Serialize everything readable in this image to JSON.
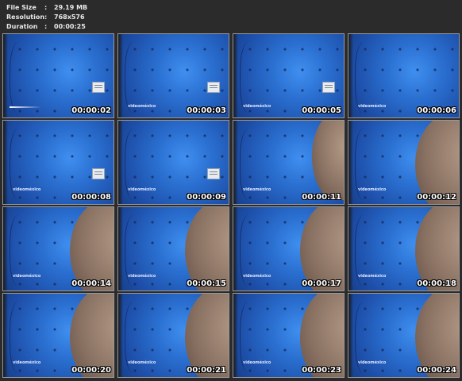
{
  "info": {
    "file_size_label": "File Size",
    "file_size_value": "29.19 MB",
    "resolution_label": "Resolution",
    "resolution_value": "768x576",
    "duration_label": "Duration",
    "duration_value": "00:00:25",
    "separator": ":"
  },
  "watermark": "videoméxico",
  "thumbnails": [
    {
      "time": "00:00:02",
      "scene": "wall-sticker",
      "watermark": false,
      "bar": true
    },
    {
      "time": "00:00:03",
      "scene": "wall-sticker",
      "watermark": true,
      "bar": false
    },
    {
      "time": "00:00:05",
      "scene": "wall-sticker",
      "watermark": true,
      "bar": false
    },
    {
      "time": "00:00:06",
      "scene": "wall",
      "watermark": true,
      "bar": false
    },
    {
      "time": "00:00:08",
      "scene": "wall-sticker",
      "watermark": true,
      "bar": false
    },
    {
      "time": "00:00:09",
      "scene": "wall-sticker",
      "watermark": true,
      "bar": false
    },
    {
      "time": "00:00:11",
      "scene": "wall-sticker-arm",
      "watermark": true,
      "bar": false
    },
    {
      "time": "00:00:12",
      "scene": "arm",
      "watermark": true,
      "bar": false
    },
    {
      "time": "00:00:14",
      "scene": "arm",
      "watermark": true,
      "bar": false
    },
    {
      "time": "00:00:15",
      "scene": "arm",
      "watermark": true,
      "bar": false
    },
    {
      "time": "00:00:17",
      "scene": "arm",
      "watermark": true,
      "bar": false
    },
    {
      "time": "00:00:18",
      "scene": "arm",
      "watermark": true,
      "bar": false
    },
    {
      "time": "00:00:20",
      "scene": "arm",
      "watermark": true,
      "bar": false
    },
    {
      "time": "00:00:21",
      "scene": "arm",
      "watermark": true,
      "bar": false
    },
    {
      "time": "00:00:23",
      "scene": "arm",
      "watermark": true,
      "bar": false
    },
    {
      "time": "00:00:24",
      "scene": "arm",
      "watermark": true,
      "bar": false
    }
  ]
}
